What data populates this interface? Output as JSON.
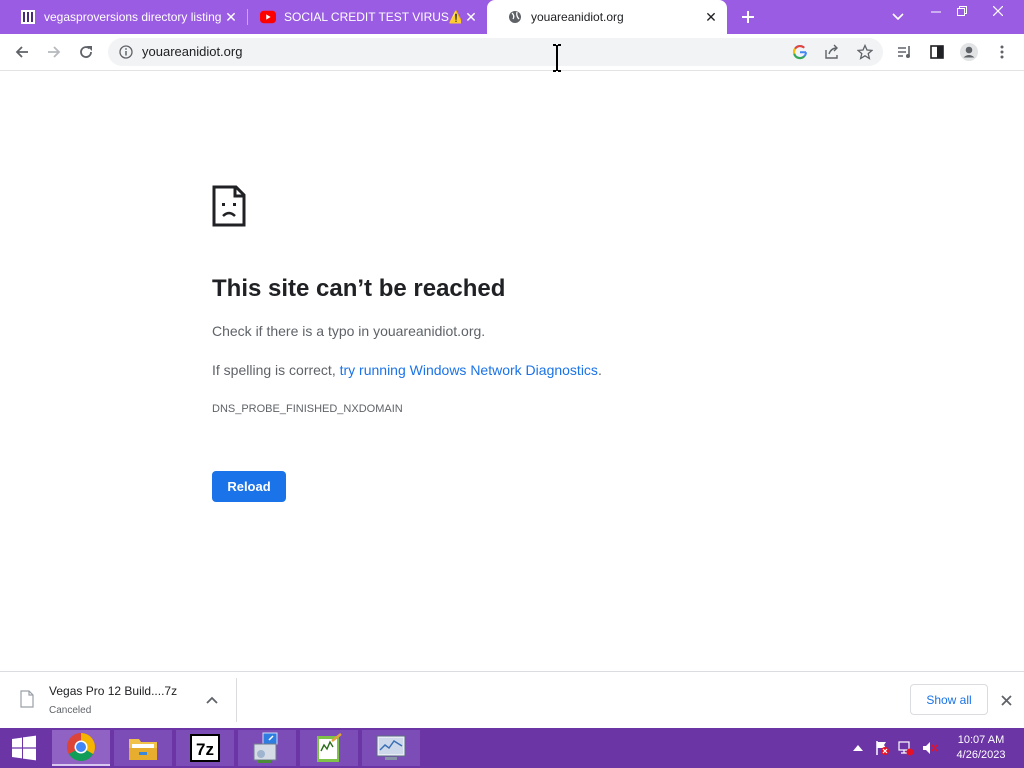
{
  "tabs": [
    {
      "title": "vegasproversions directory listing",
      "favicon": "archive-icon",
      "active": false
    },
    {
      "title": "SOCIAL CREDIT TEST VIRUS⚠️!!!",
      "favicon": "youtube-icon",
      "active": false
    },
    {
      "title": "youareanidiot.org",
      "favicon": "globe-icon",
      "active": true
    }
  ],
  "toolbar": {
    "url": "youareanidiot.org",
    "icons": [
      "back-icon",
      "forward-icon",
      "reload-icon",
      "info-icon",
      "google-icon",
      "share-icon",
      "star-icon",
      "media-icon",
      "sidepanel-icon",
      "profile-icon",
      "menu-icon"
    ]
  },
  "error": {
    "title": "This site can’t be reached",
    "line1": "Check if there is a typo in youareanidiot.org.",
    "line2_prefix": "If spelling is correct, ",
    "line2_link": "try running Windows Network Diagnostics",
    "line2_suffix": ".",
    "code": "DNS_PROBE_FINISHED_NXDOMAIN",
    "reload_label": "Reload"
  },
  "download": {
    "filename": "Vegas Pro 12 Build....7z",
    "status": "Canceled",
    "show_all_label": "Show all"
  },
  "taskbar": {
    "apps": [
      "chrome-icon",
      "file-explorer-icon",
      "7zip-icon",
      "setup-icon",
      "notepad-icon",
      "performance-monitor-icon"
    ],
    "time": "10:07 AM",
    "date": "4/26/2023"
  },
  "colors": {
    "titlebar": "#9a5ce3",
    "taskbar": "#6b35a6",
    "accent": "#1a73e8"
  }
}
